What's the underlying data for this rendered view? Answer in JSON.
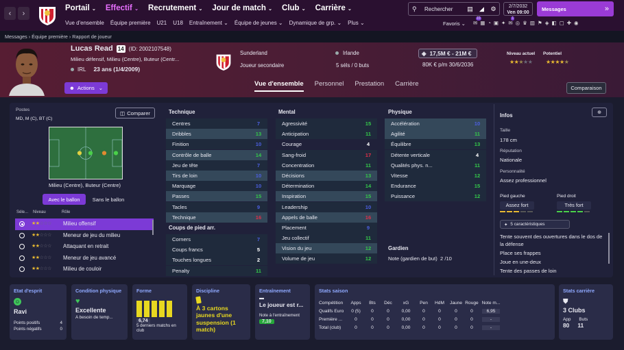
{
  "topnav": {
    "items": [
      "Portail",
      "Effectif",
      "Recrutement",
      "Jour de match",
      "Club",
      "Carrière"
    ],
    "search": "Rechercher",
    "date": "2/7/2032",
    "day_time": "Ven  09:00",
    "messages": "Messages"
  },
  "subnav": {
    "items": [
      "Vue d'ensemble",
      "Équipe première",
      "U21",
      "U18",
      "Entraînement",
      "Équipe de jeunes",
      "Dynamique de grp.",
      "Plus"
    ],
    "favoris": "Favoris",
    "badges": [
      "10",
      "1"
    ]
  },
  "breadcrumb": [
    "Messages",
    "Équipe première",
    "Rapport de joueur"
  ],
  "player": {
    "name": "Lucas Read",
    "number": "14",
    "id": "(ID: 2002107548)",
    "positions": "Milieu défensif, Milieu (Centre), Buteur (Centr...",
    "nation_code": "IRL",
    "age": "23 ans (1/4/2009)",
    "club": "Sunderland",
    "status": "Joueur secondaire",
    "nationality": "Irlande",
    "caps": "5 séls / 0 buts",
    "value": "17,5M € - 21M €",
    "wage": "80K € p/m 30/6/2036",
    "current_label": "Niveau actuel",
    "potential_label": "Potentiel",
    "current_stars": 2.5,
    "potential_stars": 4.5,
    "actions": "Actions",
    "compare_btn": "Comparaison"
  },
  "tabs": [
    "Vue d'ensemble",
    "Personnel",
    "Prestation",
    "Carrière"
  ],
  "positions_panel": {
    "title": "Postes",
    "positions": "MD, M (C), BT (C)",
    "compare": "Comparer",
    "pitch_label": "Milieu (Centre), Buteur (Centre)",
    "with_ball": "Avec le ballon",
    "without_ball": "Sans le ballon",
    "col_sel": "Séle...",
    "col_level": "Niveau",
    "col_role": "Rôle"
  },
  "roles": [
    {
      "name": "Milieu offensif",
      "stars": 2,
      "selected": true
    },
    {
      "name": "Meneur de jeu du milieu",
      "stars": 2,
      "selected": false
    },
    {
      "name": "Attaquant en retrait",
      "stars": 2,
      "selected": false
    },
    {
      "name": "Meneur de jeu avancé",
      "stars": 2,
      "selected": false
    },
    {
      "name": "Milieu de couloir",
      "stars": 2,
      "selected": false
    }
  ],
  "technique": {
    "title": "Technique",
    "attrs": [
      [
        "Centres",
        "7"
      ],
      [
        "Dribbles",
        "13"
      ],
      [
        "Finition",
        "10"
      ],
      [
        "Contrôle de balle",
        "14"
      ],
      [
        "Jeu de tête",
        "7"
      ],
      [
        "Tirs de loin",
        "10"
      ],
      [
        "Marquage",
        "10"
      ],
      [
        "Passes",
        "15"
      ],
      [
        "Tacles",
        "9"
      ],
      [
        "Technique",
        "16"
      ]
    ]
  },
  "set_pieces": {
    "title": "Coups de pied arr.",
    "attrs": [
      [
        "Corners",
        "7"
      ],
      [
        "Coups francs",
        "5"
      ],
      [
        "Touches longues",
        "2"
      ],
      [
        "Penalty",
        "11"
      ]
    ]
  },
  "mental": {
    "title": "Mental",
    "attrs": [
      [
        "Agressivité",
        "15"
      ],
      [
        "Anticipation",
        "11"
      ],
      [
        "Courage",
        "4"
      ],
      [
        "Sang-froid",
        "17"
      ],
      [
        "Concentration",
        "11"
      ],
      [
        "Décisions",
        "13"
      ],
      [
        "Détermination",
        "14"
      ],
      [
        "Inspiration",
        "15"
      ],
      [
        "Leadership",
        "10"
      ],
      [
        "Appels de balle",
        "16"
      ],
      [
        "Placement",
        "9"
      ],
      [
        "Jeu collectif",
        "11"
      ],
      [
        "Vision du jeu",
        "12"
      ],
      [
        "Volume de jeu",
        "12"
      ]
    ]
  },
  "physical": {
    "title": "Physique",
    "attrs": [
      [
        "Accélération",
        "10"
      ],
      [
        "Agilité",
        "11"
      ],
      [
        "Équilibre",
        "13"
      ],
      [
        "Détente verticale",
        "4"
      ],
      [
        "Qualités phys. n...",
        "11"
      ],
      [
        "Vitesse",
        "12"
      ],
      [
        "Endurance",
        "15"
      ],
      [
        "Puissance",
        "12"
      ]
    ]
  },
  "gardien": {
    "title": "Gardien",
    "label": "Note (gardien de but)",
    "value": "2 /10"
  },
  "info": {
    "title": "Infos",
    "height_label": "Taille",
    "height": "178 cm",
    "rep_label": "Réputation",
    "rep": "Nationale",
    "pers_label": "Personnalité",
    "pers": "Assez professionnel",
    "left_label": "Pied gauche",
    "left": "Assez fort",
    "right_label": "Pied droit",
    "right": "Très fort",
    "traits_btn": "5 caractéristiques",
    "traits": [
      "Tente souvent des ouvertures dans le dos de la défense",
      "Place ses frappes",
      "Joue en une-deux",
      "Tente des passes de loin"
    ]
  },
  "cards": {
    "morale": {
      "title": "Etat d'esprit",
      "value": "Ravi",
      "pos_label": "Points positifs",
      "pos": "4",
      "neg_label": "Points négatifs",
      "neg": "0"
    },
    "condition": {
      "title": "Condition physique",
      "value": "Excellente",
      "sub": "A besoin de temp..."
    },
    "form": {
      "title": "Forme",
      "rating": "6,74",
      "sub": "5 derniers matchs en club",
      "bars": [
        0.8,
        0.8,
        0.8,
        0.8,
        0.8
      ]
    },
    "discipline": {
      "title": "Discipline",
      "text": "À 3 cartons jaunes d'une suspension (1 match)"
    },
    "training": {
      "title": "Entraînement",
      "text": "Le joueur est r...",
      "note_label": "Note à l'entraînement",
      "note": "7,10"
    },
    "season": {
      "title": "Stats saison",
      "headers": [
        "Compétition",
        "Apps",
        "Bts",
        "Déc",
        "xG",
        "Pen",
        "HdM",
        "Jaune",
        "Rouge",
        "Note m..."
      ],
      "rows": [
        [
          "Qualifs Euro",
          "0 (5)",
          "0",
          "0",
          "0,00",
          "0",
          "0",
          "0",
          "0",
          "6,95"
        ],
        [
          "Première ...",
          "0",
          "0",
          "0",
          "0,00",
          "0",
          "0",
          "0",
          "0",
          "-"
        ],
        [
          "Total (club)",
          "0",
          "0",
          "0",
          "0,00",
          "0",
          "0",
          "0",
          "0",
          "-"
        ]
      ]
    },
    "career": {
      "title": "Stats carrière",
      "clubs": "3 Clubs",
      "apps_label": "App",
      "apps": "80",
      "goals_label": "Buts",
      "goals": "11"
    }
  }
}
